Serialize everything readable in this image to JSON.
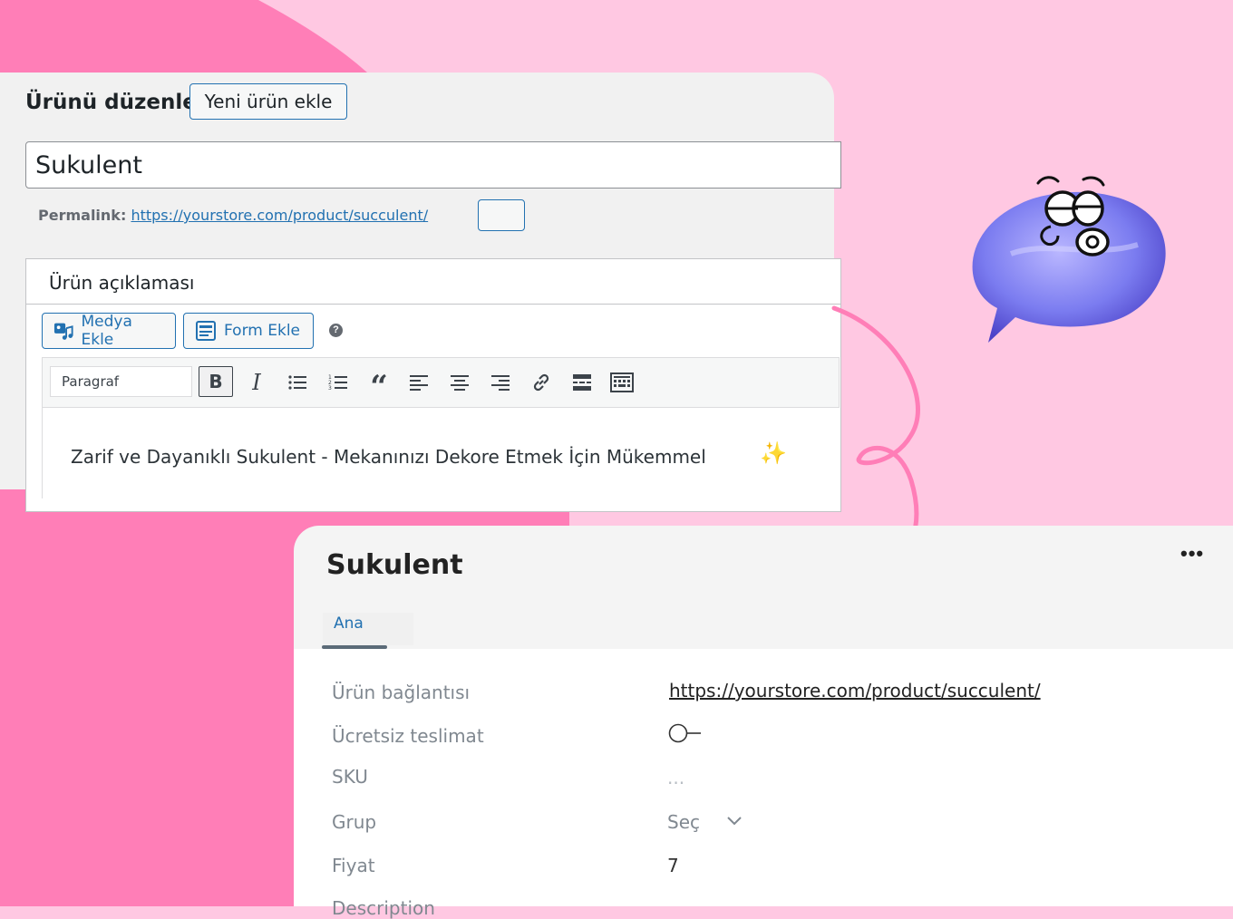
{
  "editor": {
    "title": "Ürünü düzenle",
    "add_new_label": "Yeni ürün ekle",
    "product_name": "Sukulent",
    "permalink_label": "Permalink:",
    "permalink_url": "https://yourstore.com/product/succulent/",
    "description_title": "Ürün açıklaması",
    "media_button": "Medya Ekle",
    "form_button": "Form Ekle",
    "help_glyph": "?",
    "format_select": "Paragraf",
    "toolbar_icons": [
      "bold-icon",
      "italic-icon",
      "bullet-list-icon",
      "numbered-list-icon",
      "blockquote-icon",
      "align-left-icon",
      "align-center-icon",
      "align-right-icon",
      "link-icon",
      "read-more-icon",
      "keyboard-icon"
    ],
    "bold_glyph": "B",
    "italic_glyph": "I",
    "quote_glyph": "“",
    "content_text": "Zarif ve Dayanıklı Sukulent - Mekanınızı Dekore Etmek İçin Mükemmel",
    "sparkle_glyph": "✨"
  },
  "product": {
    "title": "Sukulent",
    "more_glyph": "•••",
    "tabs": [
      {
        "label": "Ana"
      }
    ],
    "fields": {
      "link_label": "Ürün bağlantısı",
      "link_value": "https://yourstore.com/product/succulent/",
      "free_delivery_label": "Ücretsiz teslimat",
      "sku_label": "SKU",
      "sku_placeholder": "...",
      "group_label": "Grup",
      "group_value": "Seç",
      "price_label": "Fiyat",
      "price_value": "7",
      "description_label": "Description"
    }
  },
  "colors": {
    "background_pink": "#ffc8e2",
    "accent_pink": "#ff7eb7",
    "link_blue": "#2271b1",
    "mascot_purple": "#7b7cf0"
  }
}
